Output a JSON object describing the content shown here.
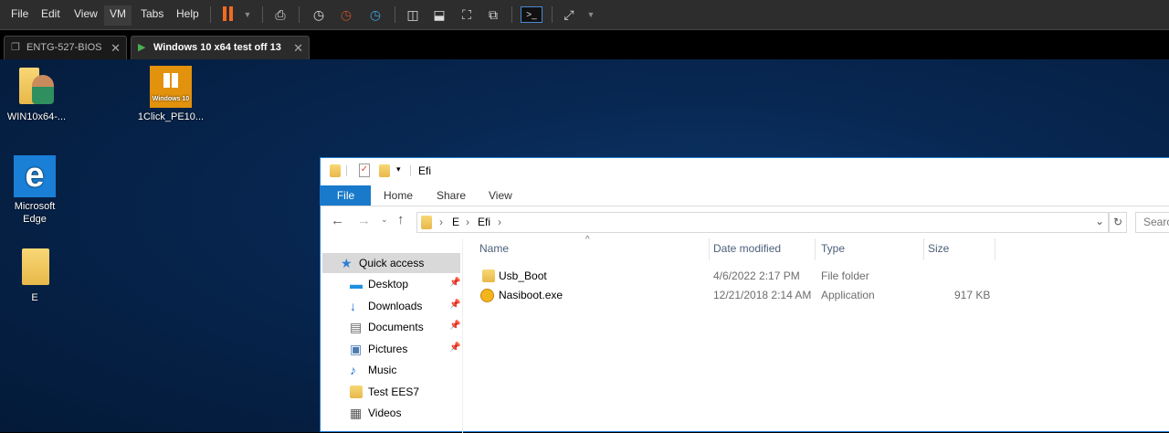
{
  "vm": {
    "menu": [
      "File",
      "Edit",
      "View",
      "VM",
      "Tabs",
      "Help"
    ],
    "active_menu": "VM",
    "tabs": [
      {
        "label": "ENTG-527-BIOS",
        "active": false
      },
      {
        "label": "Windows 10 x64 test off 13",
        "active": true
      }
    ]
  },
  "desktop": {
    "icons": [
      {
        "label": "WIN10x64-..."
      },
      {
        "label": "1Click_PE10...",
        "badge": "Windows 10"
      },
      {
        "label": "Microsoft Edge"
      },
      {
        "label": "E"
      }
    ]
  },
  "explorer": {
    "title": "Efi",
    "ribbon_tabs": [
      "File",
      "Home",
      "Share",
      "View"
    ],
    "breadcrumb": [
      "E",
      "Efi"
    ],
    "search_placeholder": "Search",
    "nav": [
      {
        "label": "Quick access",
        "selected": true
      },
      {
        "label": "Desktop",
        "pinned": true
      },
      {
        "label": "Downloads",
        "pinned": true
      },
      {
        "label": "Documents",
        "pinned": true
      },
      {
        "label": "Pictures",
        "pinned": true
      },
      {
        "label": "Music"
      },
      {
        "label": "Test EES7"
      },
      {
        "label": "Videos"
      }
    ],
    "columns": [
      "Name",
      "Date modified",
      "Type",
      "Size"
    ],
    "files": [
      {
        "name": "Usb_Boot",
        "date": "4/6/2022 2:17 PM",
        "type": "File folder",
        "size": ""
      },
      {
        "name": "Nasiboot.exe",
        "date": "12/21/2018 2:14 AM",
        "type": "Application",
        "size": "917 KB"
      }
    ]
  },
  "colors": {
    "accent": "#1979ca",
    "vm_pause": "#f26b21"
  }
}
